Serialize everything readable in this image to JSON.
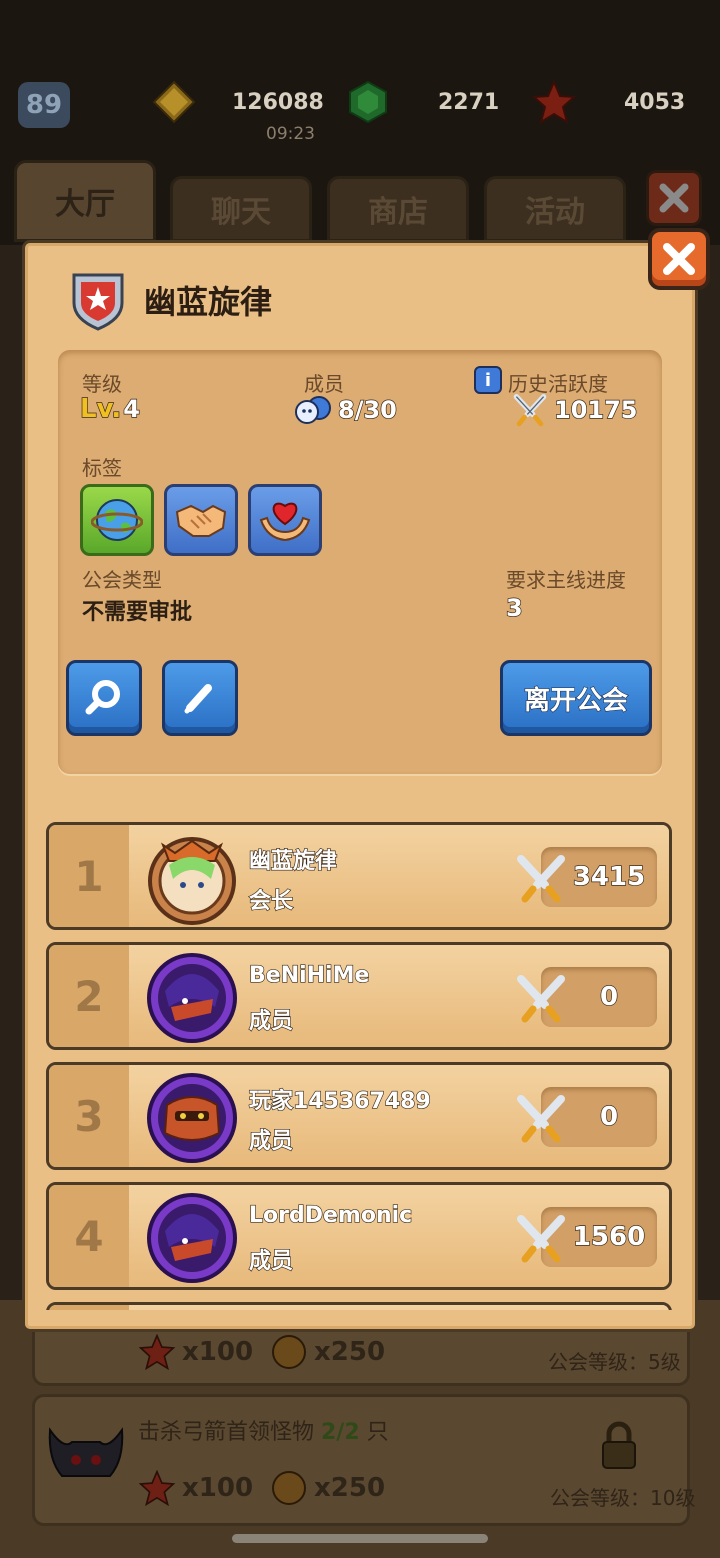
{
  "top_bar": {
    "player_level": "89",
    "resources": [
      {
        "icon": "gold-coin-icon",
        "value": "126088"
      },
      {
        "icon": "green-gem-icon",
        "value": "2271"
      },
      {
        "icon": "red-star-icon",
        "value": "4053"
      }
    ],
    "clock": "09:23"
  },
  "tabs": [
    {
      "label": "大厅",
      "active": true
    },
    {
      "label": "聊天",
      "active": false
    },
    {
      "label": "商店",
      "active": false
    },
    {
      "label": "活动",
      "active": false
    }
  ],
  "guild": {
    "name": "幽蓝旋律",
    "level_label": "等级",
    "level_value": "4",
    "level_prefix": "Lv.",
    "members_label": "成员",
    "members_value": "8/30",
    "activity_label": "历史活跃度",
    "activity_value": "10175",
    "tags_label": "标签",
    "tags": [
      "globe-icon",
      "handshake-icon",
      "heart-hands-icon"
    ],
    "type_label": "公会类型",
    "type_value": "不需要审批",
    "progress_label": "要求主线进度",
    "progress_value": "3",
    "leave_button": "离开公会"
  },
  "members": [
    {
      "rank": "1",
      "name": "幽蓝旋律",
      "role": "会长",
      "score": "3415",
      "avatar": "green-hair-hero-avatar"
    },
    {
      "rank": "2",
      "name": "BeNiHiMe",
      "role": "成员",
      "score": "0",
      "avatar": "purple-ninja-avatar"
    },
    {
      "rank": "3",
      "name": "玩家145367489",
      "role": "成员",
      "score": "0",
      "avatar": "orange-beast-avatar"
    },
    {
      "rank": "4",
      "name": "LordDemonic",
      "role": "成员",
      "score": "1560",
      "avatar": "purple-ninja-avatar"
    }
  ],
  "background_tasks": {
    "reward_star": "x100",
    "reward_xp": "x250",
    "task1_requirement": "公会等级：5级",
    "task2_text_pre": "击杀弓箭首领怪物 ",
    "task2_progress": "2/2",
    "task2_text_post": " 只",
    "task2_requirement": "公会等级：10级"
  },
  "colors": {
    "modal_bg": "#e9bf85",
    "button_blue": "#2a6fc4",
    "close_orange": "#e56a2c"
  }
}
